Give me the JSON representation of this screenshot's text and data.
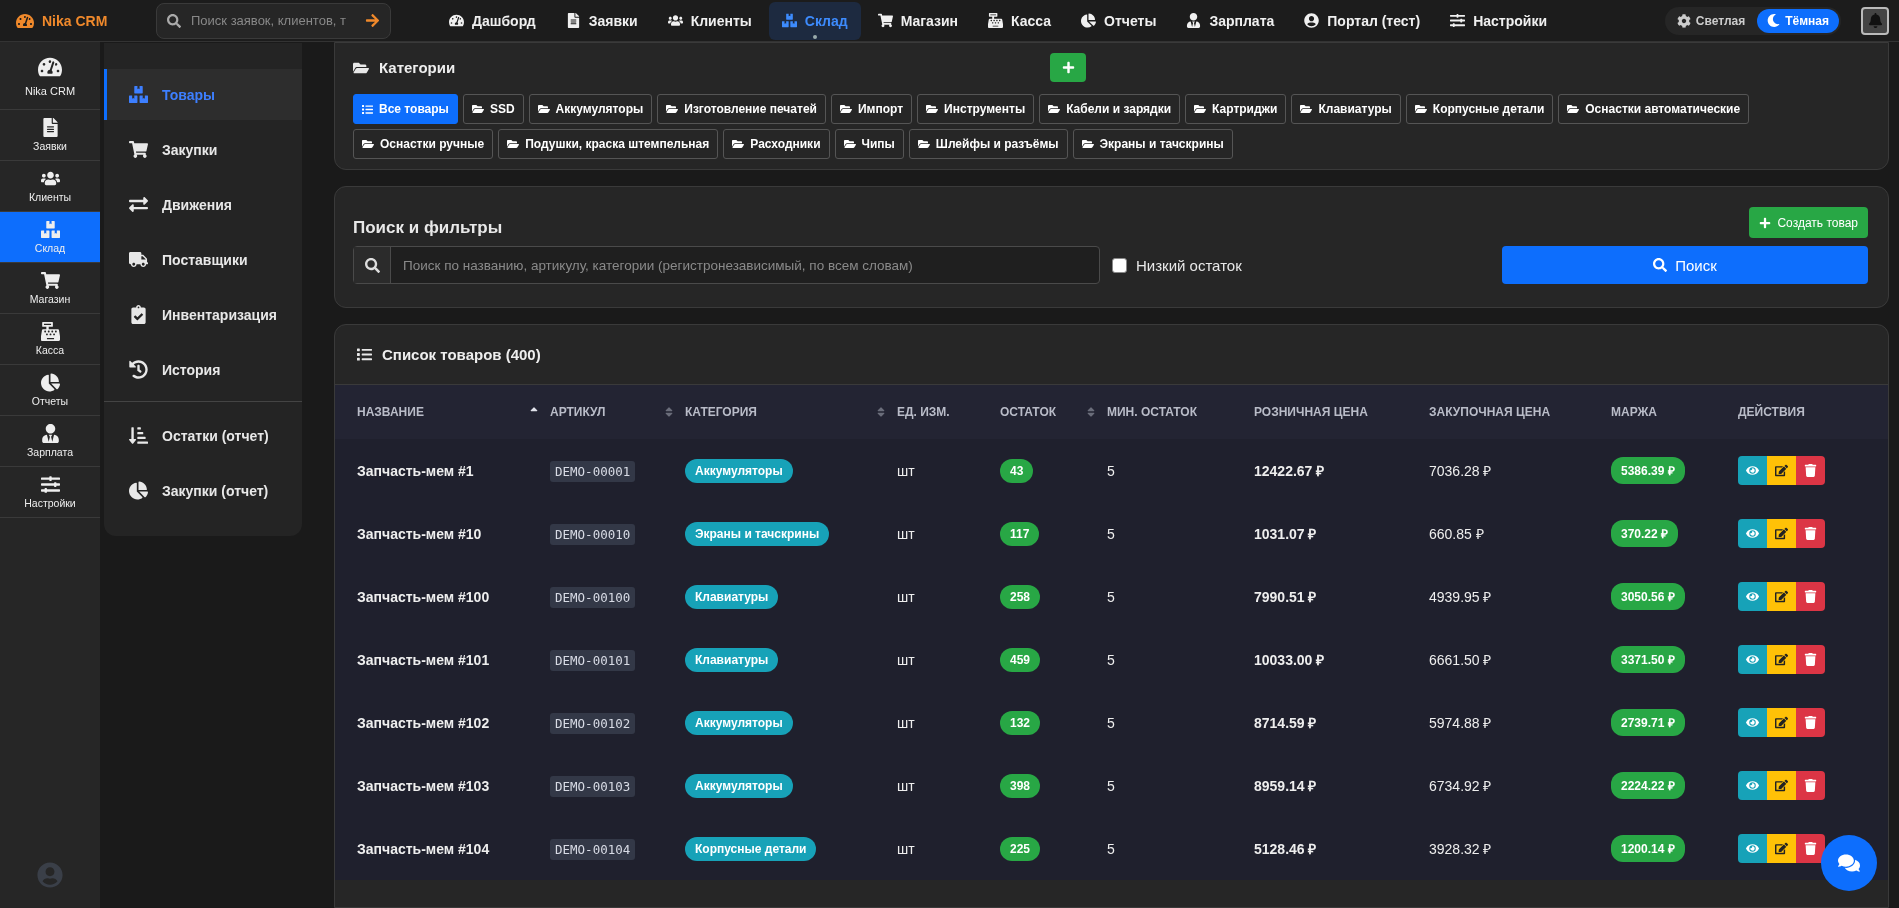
{
  "topbar": {
    "brand": "Nika CRM",
    "search": {
      "placeholder": "Поиск заявок, клиентов, т"
    },
    "nav": [
      {
        "label": "Дашборд",
        "selected": false
      },
      {
        "label": "Заявки",
        "selected": false
      },
      {
        "label": "Клиенты",
        "selected": false
      },
      {
        "label": "Склад",
        "selected": true
      },
      {
        "label": "Магазин",
        "selected": false
      },
      {
        "label": "Касса",
        "selected": false
      },
      {
        "label": "Отчеты",
        "selected": false
      },
      {
        "label": "Зарплата",
        "selected": false
      },
      {
        "label": "Портал (тест)",
        "selected": false
      },
      {
        "label": "Настройки",
        "selected": false
      }
    ],
    "theme": [
      {
        "label": "Светлая",
        "selected": false
      },
      {
        "label": "Тёмная",
        "selected": true
      }
    ]
  },
  "rail": {
    "brand": "Nika CRM",
    "items": [
      {
        "label": "Заявки",
        "selected": false
      },
      {
        "label": "Клиенты",
        "selected": false
      },
      {
        "label": "Склад",
        "selected": true
      },
      {
        "label": "Магазин",
        "selected": false
      },
      {
        "label": "Касса",
        "selected": false
      },
      {
        "label": "Отчеты",
        "selected": false
      },
      {
        "label": "Зарплата",
        "selected": false
      },
      {
        "label": "Настройки",
        "selected": false
      }
    ]
  },
  "submenu": {
    "items": [
      {
        "label": "Товары",
        "selected": true
      },
      {
        "label": "Закупки",
        "selected": false
      },
      {
        "label": "Движения",
        "selected": false
      },
      {
        "label": "Поставщики",
        "selected": false
      },
      {
        "label": "Инвентаризация",
        "selected": false
      },
      {
        "label": "История",
        "selected": false
      }
    ],
    "reports": [
      {
        "label": "Остатки (отчет)",
        "selected": false
      },
      {
        "label": "Закупки (отчет)",
        "selected": false
      }
    ]
  },
  "categories": {
    "title": "Категории",
    "chips": [
      {
        "label": "Все товары",
        "selected": true
      },
      {
        "label": "SSD",
        "selected": false
      },
      {
        "label": "Аккумуляторы",
        "selected": false
      },
      {
        "label": "Изготовление печатей",
        "selected": false
      },
      {
        "label": "Импорт",
        "selected": false
      },
      {
        "label": "Инструменты",
        "selected": false
      },
      {
        "label": "Кабели и зарядки",
        "selected": false
      },
      {
        "label": "Картриджи",
        "selected": false
      },
      {
        "label": "Клавиатуры",
        "selected": false
      },
      {
        "label": "Корпусные детали",
        "selected": false
      },
      {
        "label": "Оснастки автоматические",
        "selected": false
      },
      {
        "label": "Оснастки ручные",
        "selected": false
      },
      {
        "label": "Подушки, краска штемпельная",
        "selected": false
      },
      {
        "label": "Расходники",
        "selected": false
      },
      {
        "label": "Чипы",
        "selected": false
      },
      {
        "label": "Шлейфы и разъёмы",
        "selected": false
      },
      {
        "label": "Экраны и тачскрины",
        "selected": false
      }
    ]
  },
  "filters": {
    "title": "Поиск и фильтры",
    "create_button": "Создать товар",
    "search": {
      "placeholder": "Поиск по названию, артикулу, категории (регистронезависимый, по всем словам)"
    },
    "low_stock": {
      "label": "Низкий остаток",
      "checked": false
    },
    "search_button": "Поиск"
  },
  "products": {
    "title": "Список товаров (400)",
    "columns": [
      {
        "label": "НАЗВАНИЕ",
        "sortable": true,
        "sorted": true
      },
      {
        "label": "АРТИКУЛ",
        "sortable": true,
        "sorted": false
      },
      {
        "label": "КАТЕГОРИЯ",
        "sortable": true,
        "sorted": false
      },
      {
        "label": "ЕД. ИЗМ.",
        "sortable": false
      },
      {
        "label": "ОСТАТОК",
        "sortable": true,
        "sorted": false
      },
      {
        "label": "МИН. ОСТАТОК",
        "sortable": false
      },
      {
        "label": "РОЗНИЧНАЯ ЦЕНА",
        "sortable": false
      },
      {
        "label": "ЗАКУПОЧНАЯ ЦЕНА",
        "sortable": false
      },
      {
        "label": "МАРЖА",
        "sortable": false
      },
      {
        "label": "ДЕЙСТВИЯ",
        "sortable": false
      }
    ],
    "rows": [
      {
        "name": "Запчасть-мем #1",
        "sku": "DEMO-00001",
        "category": "Аккумуляторы",
        "unit": "шт",
        "stock": "43",
        "min_stock": "5",
        "retail": "12422.67 ₽",
        "purchase": "7036.28 ₽",
        "margin": "5386.39 ₽"
      },
      {
        "name": "Запчасть-мем #10",
        "sku": "DEMO-00010",
        "category": "Экраны и тачскрины",
        "unit": "шт",
        "stock": "117",
        "min_stock": "5",
        "retail": "1031.07 ₽",
        "purchase": "660.85 ₽",
        "margin": "370.22 ₽"
      },
      {
        "name": "Запчасть-мем #100",
        "sku": "DEMO-00100",
        "category": "Клавиатуры",
        "unit": "шт",
        "stock": "258",
        "min_stock": "5",
        "retail": "7990.51 ₽",
        "purchase": "4939.95 ₽",
        "margin": "3050.56 ₽"
      },
      {
        "name": "Запчасть-мем #101",
        "sku": "DEMO-00101",
        "category": "Клавиатуры",
        "unit": "шт",
        "stock": "459",
        "min_stock": "5",
        "retail": "10033.00 ₽",
        "purchase": "6661.50 ₽",
        "margin": "3371.50 ₽"
      },
      {
        "name": "Запчасть-мем #102",
        "sku": "DEMO-00102",
        "category": "Аккумуляторы",
        "unit": "шт",
        "stock": "132",
        "min_stock": "5",
        "retail": "8714.59 ₽",
        "purchase": "5974.88 ₽",
        "margin": "2739.71 ₽"
      },
      {
        "name": "Запчасть-мем #103",
        "sku": "DEMO-00103",
        "category": "Аккумуляторы",
        "unit": "шт",
        "stock": "398",
        "min_stock": "5",
        "retail": "8959.14 ₽",
        "purchase": "6734.92 ₽",
        "margin": "2224.22 ₽"
      },
      {
        "name": "Запчасть-мем #104",
        "sku": "DEMO-00104",
        "category": "Корпусные детали",
        "unit": "шт",
        "stock": "225",
        "min_stock": "5",
        "retail": "5128.46 ₽",
        "purchase": "3928.32 ₽",
        "margin": "1200.14 ₽"
      }
    ]
  }
}
